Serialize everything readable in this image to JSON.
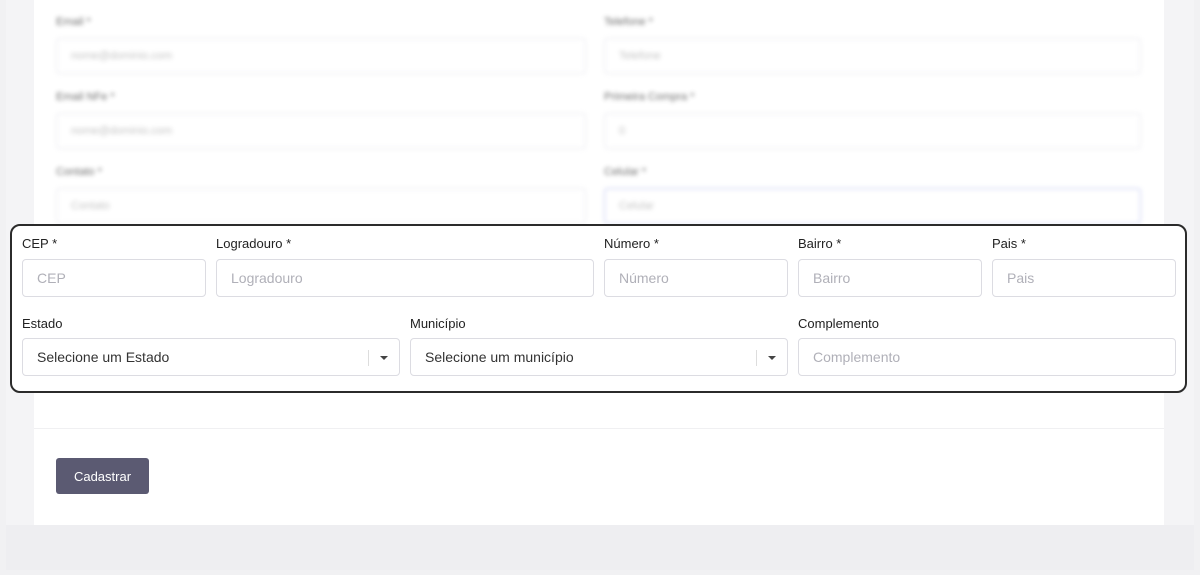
{
  "blurred_form": {
    "email_label": "Email *",
    "email_placeholder": "nome@dominio.com",
    "telefone_label": "Telefone *",
    "telefone_placeholder": "Telefone",
    "email_nfe_label": "Email NFe *",
    "email_nfe_placeholder": "nome@dominio.com",
    "primeira_compra_label": "Primeira Compra *",
    "primeira_compra_value": "0",
    "contato_label": "Contato *",
    "contato_placeholder": "Contato",
    "celular_label": "Celular *",
    "celular_placeholder": "Celular"
  },
  "address": {
    "cep_label": "CEP *",
    "cep_placeholder": "CEP",
    "logradouro_label": "Logradouro *",
    "logradouro_placeholder": "Logradouro",
    "numero_label": "Número *",
    "numero_placeholder": "Número",
    "bairro_label": "Bairro *",
    "bairro_placeholder": "Bairro",
    "pais_label": "Pais *",
    "pais_placeholder": "Pais",
    "estado_label": "Estado",
    "estado_selected": "Selecione um Estado",
    "municipio_label": "Município",
    "municipio_selected": "Selecione um município",
    "complemento_label": "Complemento",
    "complemento_placeholder": "Complemento"
  },
  "actions": {
    "submit_label": "Cadastrar"
  }
}
